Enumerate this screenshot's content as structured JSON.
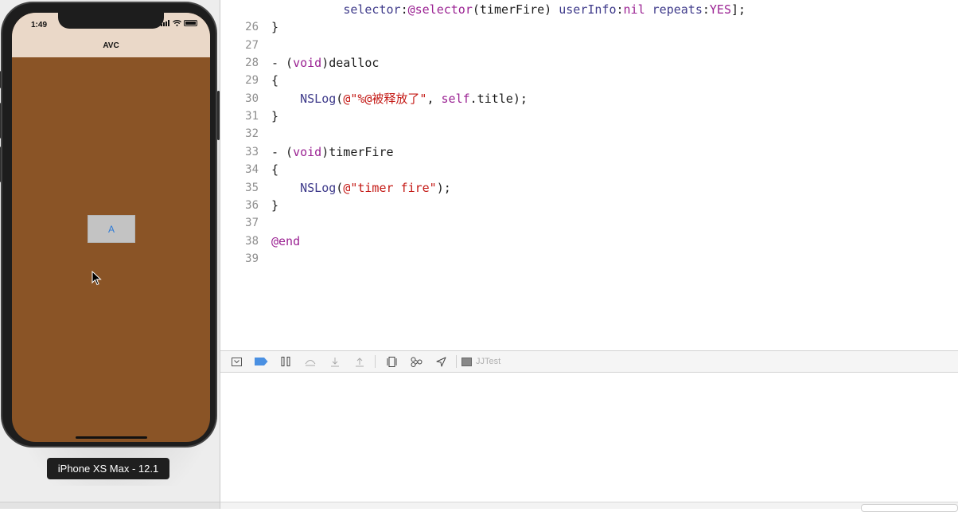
{
  "simulator": {
    "status_time": "1:49",
    "nav_title": "AVC",
    "button_a_label": "A",
    "device_label": "iPhone XS Max - 12.1",
    "screen_color": "#8a5426",
    "navbar_color": "#ead8c8"
  },
  "editor": {
    "lines": [
      {
        "num": "",
        "parts": [
          [
            "plain",
            "          "
          ],
          [
            "fn",
            "selector"
          ],
          [
            "plain",
            ":"
          ],
          [
            "kw",
            "@selector"
          ],
          [
            "plain",
            "(timerFire) "
          ],
          [
            "fn",
            "userInfo"
          ],
          [
            "plain",
            ":"
          ],
          [
            "kw",
            "nil"
          ],
          [
            "plain",
            " "
          ],
          [
            "fn",
            "repeats"
          ],
          [
            "plain",
            ":"
          ],
          [
            "kw",
            "YES"
          ],
          [
            "plain",
            "];"
          ]
        ]
      },
      {
        "num": "26",
        "parts": [
          [
            "plain",
            "}"
          ]
        ]
      },
      {
        "num": "27",
        "parts": []
      },
      {
        "num": "28",
        "parts": [
          [
            "plain",
            "- ("
          ],
          [
            "kw",
            "void"
          ],
          [
            "plain",
            ")dealloc"
          ]
        ]
      },
      {
        "num": "29",
        "parts": [
          [
            "plain",
            "{"
          ]
        ]
      },
      {
        "num": "30",
        "parts": [
          [
            "plain",
            "    "
          ],
          [
            "fn",
            "NSLog"
          ],
          [
            "plain",
            "("
          ],
          [
            "str",
            "@\"%@被释放了\""
          ],
          [
            "plain",
            ", "
          ],
          [
            "kw",
            "self"
          ],
          [
            "plain",
            ".title);"
          ]
        ]
      },
      {
        "num": "31",
        "parts": [
          [
            "plain",
            "}"
          ]
        ]
      },
      {
        "num": "32",
        "parts": []
      },
      {
        "num": "33",
        "parts": [
          [
            "plain",
            "- ("
          ],
          [
            "kw",
            "void"
          ],
          [
            "plain",
            ")timerFire"
          ]
        ]
      },
      {
        "num": "34",
        "parts": [
          [
            "plain",
            "{"
          ]
        ]
      },
      {
        "num": "35",
        "parts": [
          [
            "plain",
            "    "
          ],
          [
            "fn",
            "NSLog"
          ],
          [
            "plain",
            "("
          ],
          [
            "str",
            "@\"timer fire\""
          ],
          [
            "plain",
            ");"
          ]
        ]
      },
      {
        "num": "36",
        "parts": [
          [
            "plain",
            "}"
          ]
        ]
      },
      {
        "num": "37",
        "parts": []
      },
      {
        "num": "38",
        "parts": [
          [
            "kw",
            "@end"
          ]
        ]
      },
      {
        "num": "39",
        "parts": []
      }
    ]
  },
  "debug_bar": {
    "target_name": "JJTest",
    "buttons": [
      "hide-debug-area-icon",
      "breakpoints-toggle-icon",
      "pause-icon",
      "step-over-icon",
      "step-into-icon",
      "step-out-icon",
      "view-hierarchy-icon",
      "memory-graph-icon",
      "simulate-location-icon"
    ],
    "accent_color": "#4a90e2"
  }
}
